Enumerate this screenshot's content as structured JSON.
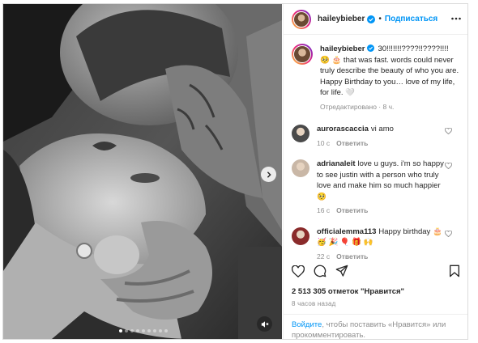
{
  "post": {
    "username": "haileybieber",
    "follow_label": "Подписаться",
    "separator": "•",
    "caption": "30!!!!!!!????!!????!!!! 🥺 🎂 that was fast. words could never truly describe the beauty of who you are. Happy Birthday to you… love of my life, for life. 🤍",
    "caption_meta": "Отредактировано · 8 ч.",
    "likes": "2 513 305 отметок \"Нравится\"",
    "time_ago": "8 часов назад",
    "login_link": "Войдите",
    "login_text": ", чтобы поставить «Нравится» или прокомментировать."
  },
  "comments": [
    {
      "user": "aurorascaccia",
      "text": "vi amo",
      "time": "10 с",
      "reply": "Ответить"
    },
    {
      "user": "adrianaleit",
      "text": "love u guys. i'm so happy to see justin with a person who truly love and make him so much happier 🥺",
      "time": "16 с",
      "reply": "Ответить"
    },
    {
      "user": "officialemma113",
      "text": "Happy birthday 🎂 🥳 🎉 🎈 🎁 🙌",
      "time": "22 с",
      "reply": "Ответить"
    }
  ],
  "media": {
    "dot_count": 9,
    "active_dot": 0
  },
  "icons": {
    "verified": "verified-badge-icon",
    "more": "more-options-icon",
    "next": "chevron-right-icon",
    "mute": "muted-speaker-icon",
    "like": "heart-icon",
    "comment": "comment-icon",
    "share": "share-icon",
    "save": "bookmark-icon"
  },
  "colors": {
    "link_blue": "#0095f6",
    "text": "#262626",
    "secondary": "#8e8e8e"
  }
}
